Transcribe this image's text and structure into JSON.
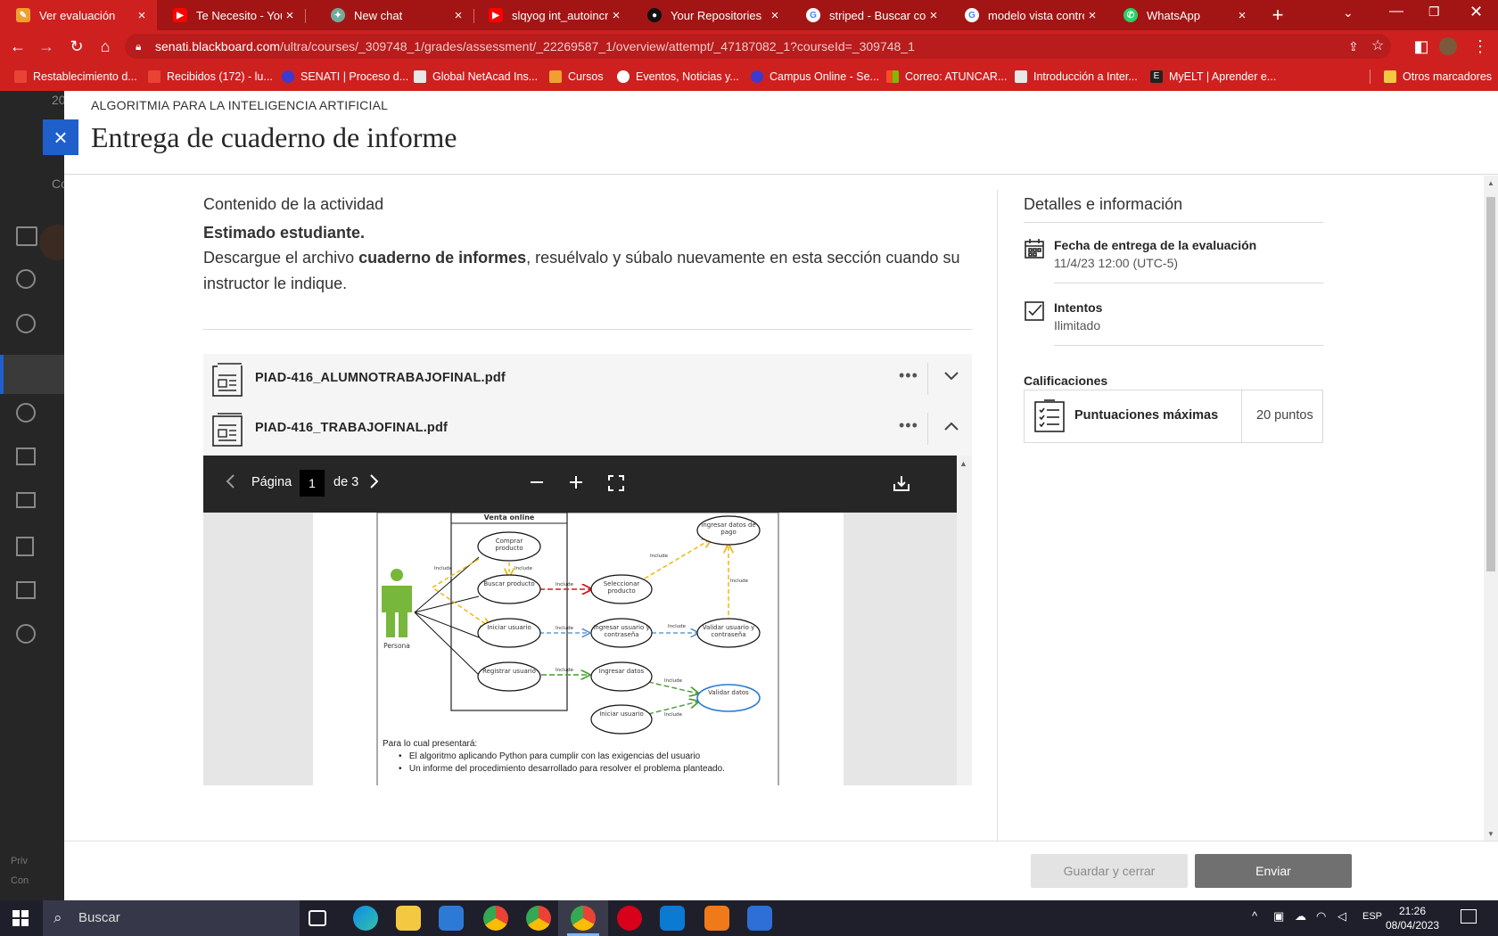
{
  "browser": {
    "tabs": [
      {
        "title": "Ver evaluación",
        "active": true
      },
      {
        "title": "Te Necesito - YouTube"
      },
      {
        "title": "New chat"
      },
      {
        "title": "slqyog int_autoincrement"
      },
      {
        "title": "Your Repositories"
      },
      {
        "title": "striped - Buscar con Google"
      },
      {
        "title": "modelo vista controlador"
      },
      {
        "title": "WhatsApp"
      }
    ],
    "new_tab": "+",
    "url_host": "senati.blackboard.com",
    "url_path": "/ultra/courses/_309748_1/grades/assessment/_22269587_1/overview/attempt/_47187082_1?courseId=_309748_1",
    "bookmarks": [
      "Restablecimiento d...",
      "Recibidos (172) - lu...",
      "SENATI | Proceso d...",
      "Global NetAcad Ins...",
      "Cursos",
      "Eventos, Noticias y...",
      "Campus Online - Se...",
      "Correo: ATUNCAR...",
      "Introducción a Inter...",
      "MyELT | Aprender e..."
    ],
    "other_bookmarks": "Otros marcadores"
  },
  "panel": {
    "course_name": "ALGORITMIA PARA LA INTELIGENCIA ARTIFICIAL",
    "title": "Entrega de cuaderno de informe",
    "close": "×"
  },
  "activity": {
    "section_title": "Contenido de la actividad",
    "greeting": "Estimado estudiante.",
    "text_before": "Descargue el archivo ",
    "text_bold": "cuaderno de informes",
    "text_after": ", resuélvalo y súbalo nuevamente en esta sección cuando su instructor le indique.",
    "files": [
      {
        "name": "PIAD-416_ALUMNOTRABAJOFINAL.pdf",
        "expanded": false
      },
      {
        "name": "PIAD-416_TRABAJOFINAL.pdf",
        "expanded": true
      }
    ],
    "more": "•••"
  },
  "viewer": {
    "page_label": "Página",
    "page_number": "1",
    "page_total": "de 3",
    "pdf": {
      "system": "Venta online",
      "actor": "Persona",
      "use_cases": {
        "comprar": "Comprar producto",
        "buscar": "Buscar producto",
        "iniciar": "Iniciar usuario",
        "registrar": "Registrar usuario",
        "seleccionar": "Seleccionar producto",
        "ingresar_usuario": "Ingresar usuario y contraseña",
        "ingresar_datos": "Ingresar datos",
        "iniciar_usuario2": "Iniciar usuario",
        "ingresar_pago": "Ingresar datos de pago",
        "validar_usuario": "Validar usuario y contraseña",
        "validar_datos": "Validar datos"
      },
      "include_label": "Include",
      "footer_lead": "Para lo cual presentará:",
      "bullets": [
        "El algoritmo aplicando Python para cumplir con las exigencias del usuario",
        "Un informe del procedimiento desarrollado para resolver el problema planteado."
      ]
    }
  },
  "details": {
    "title": "Detalles e información",
    "due_label": "Fecha de entrega de la evaluación",
    "due_value": "11/4/23 12:00 (UTC-5)",
    "attempts_label": "Intentos",
    "attempts_value": "Ilimitado",
    "grading_title": "Calificaciones",
    "max_label": "Puntuaciones máximas",
    "max_value": "20 puntos"
  },
  "footer": {
    "save": "Guardar y cerrar",
    "send": "Enviar"
  },
  "background": {
    "partial_number": "20",
    "partial_tab": "Co",
    "partial_footer1": "Priv",
    "partial_footer2": "Con"
  },
  "taskbar": {
    "search": "Buscar",
    "language": "ESP",
    "time": "21:26",
    "date": "08/04/2023"
  }
}
